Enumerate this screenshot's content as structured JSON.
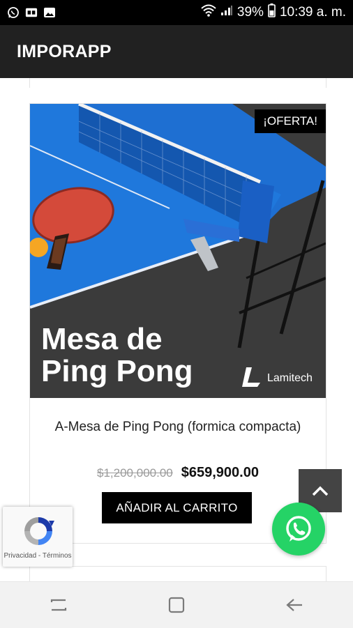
{
  "status_bar": {
    "battery_percent": "39%",
    "time": "10:39 a. m.",
    "icons": [
      "whatsapp-icon",
      "gallery-icon",
      "image-icon",
      "wifi-icon",
      "signal-icon",
      "battery-icon"
    ]
  },
  "app_bar": {
    "title": "IMPORAPP"
  },
  "product": {
    "badge": "¡OFERTA!",
    "image_title_line1": "Mesa de",
    "image_title_line2": "Ping Pong",
    "image_brand": "Lamitech",
    "name": "A-Mesa de Ping Pong (formica compacta)",
    "old_price": "$1,200,000.00",
    "new_price": "$659,900.00",
    "add_to_cart_label": "AÑADIR AL CARRITO"
  },
  "recaptcha": {
    "text": "Privacidad - Términos"
  },
  "floating": {
    "scroll_top_icon": "chevron-up-icon",
    "whatsapp_icon": "whatsapp-icon"
  },
  "nav_bar": {
    "icons": [
      "recent-apps-icon",
      "home-icon",
      "back-icon"
    ]
  },
  "colors": {
    "app_bar": "#212121",
    "status_bar": "#000000",
    "whatsapp_green": "#25d366",
    "table_blue": "#1e6fd2",
    "badge": "#000000"
  }
}
